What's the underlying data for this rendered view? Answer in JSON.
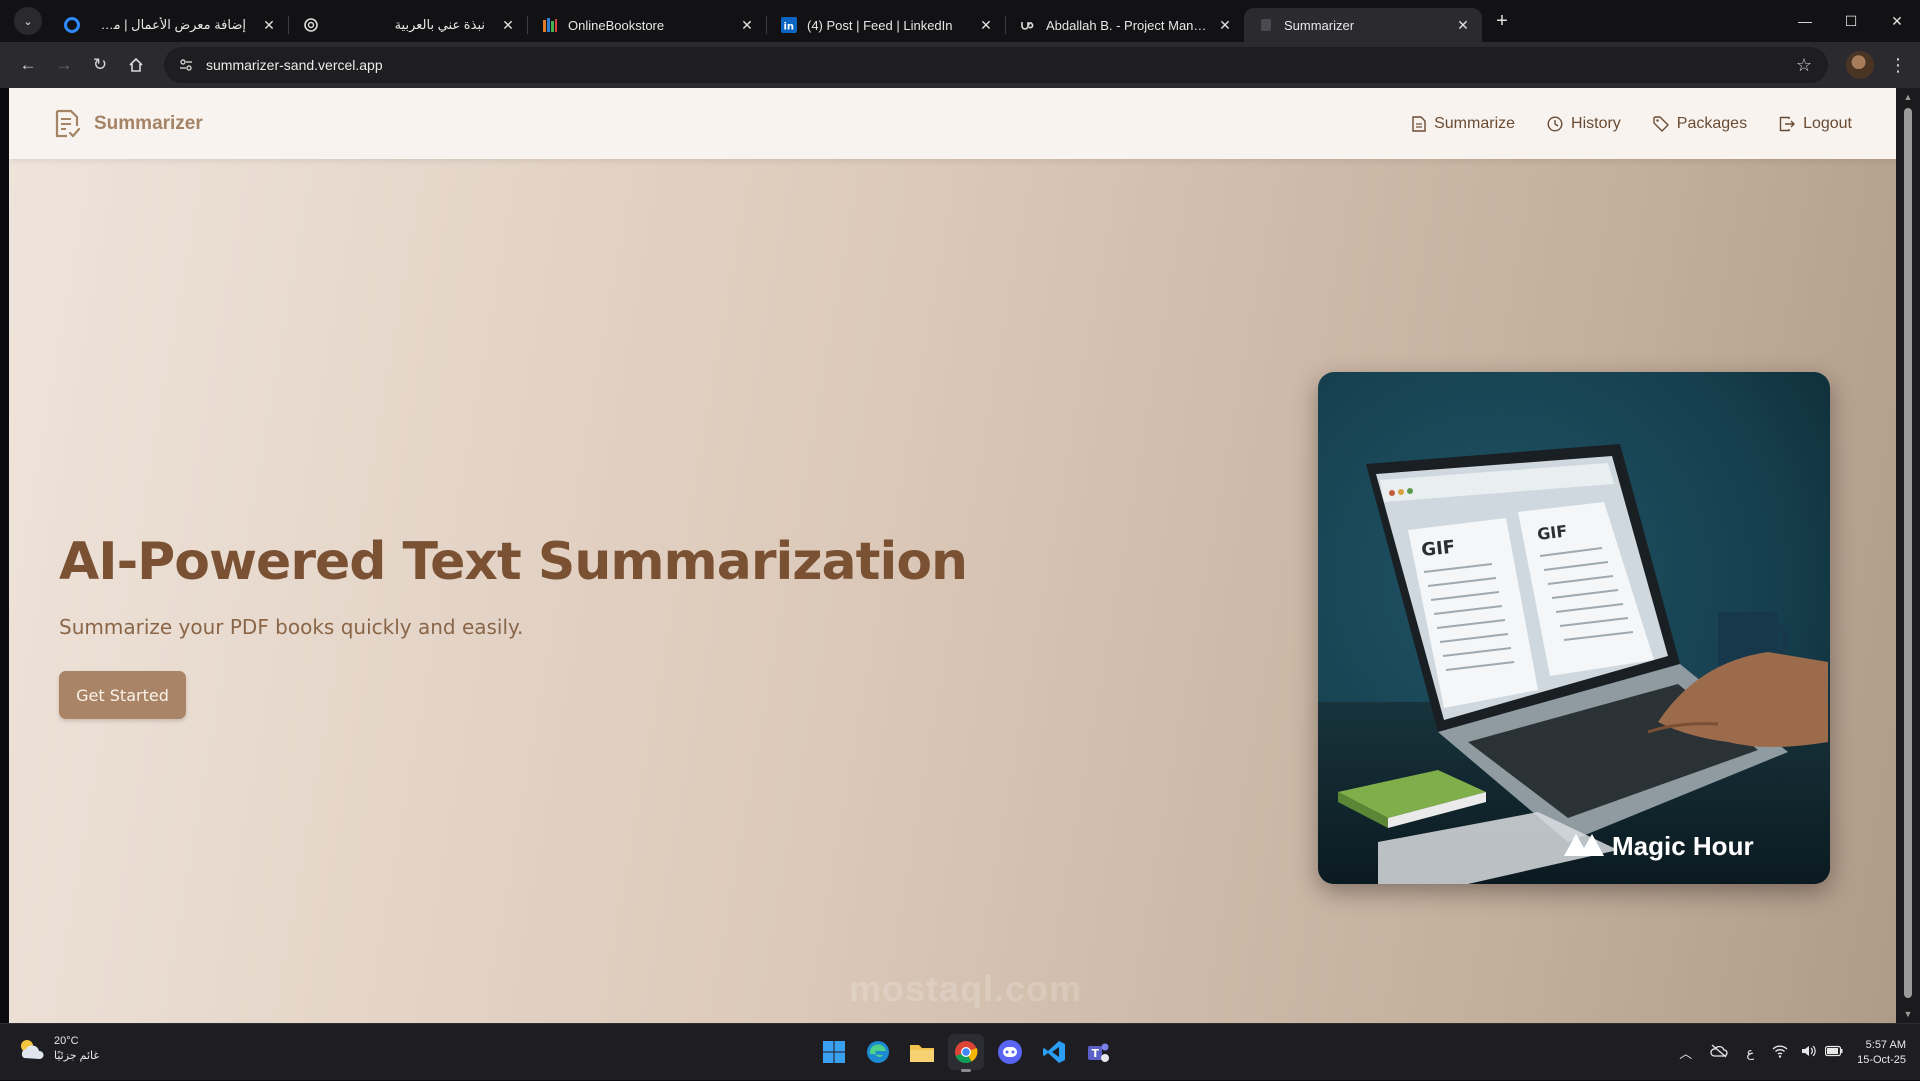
{
  "browser": {
    "tabs": [
      {
        "title": "إضافة معرض الأعمال | مستقل",
        "icon": "mostaql-icon",
        "rtl": true,
        "active": false
      },
      {
        "title": "نبذة عني بالعربية",
        "icon": "chatgpt-icon",
        "rtl": true,
        "active": false
      },
      {
        "title": "OnlineBookstore",
        "icon": "bookstore-icon",
        "rtl": false,
        "active": false
      },
      {
        "title": "(4) Post | Feed | LinkedIn",
        "icon": "linkedin-icon",
        "rtl": false,
        "active": false
      },
      {
        "title": "Abdallah B. - Project Managem",
        "icon": "upwork-icon",
        "rtl": false,
        "active": false
      },
      {
        "title": "Summarizer",
        "icon": "page-icon",
        "rtl": false,
        "active": true
      }
    ],
    "url": "summarizer-sand.vercel.app"
  },
  "site": {
    "brand": "Summarizer",
    "nav": {
      "summarize": "Summarize",
      "history": "History",
      "packages": "Packages",
      "logout": "Logout"
    },
    "hero": {
      "title": "AI-Powered Text Summarization",
      "subtitle": "Summarize your PDF books quickly and easily.",
      "cta": "Get Started",
      "image_labels": {
        "left_doc": "GIF",
        "right_doc": "GIF",
        "brand": "Magic Hour"
      }
    },
    "colors": {
      "brand": "#a48366",
      "title": "#7a5233",
      "button": "#a98466",
      "nav_bg": "#f8f3ee"
    }
  },
  "watermark": "mostaql.com",
  "taskbar": {
    "weather": {
      "temp": "20°C",
      "condition": "غائم جزئيًا"
    },
    "tray_lang": "ع",
    "time": "5:57 AM",
    "date": "15-Oct-25"
  }
}
